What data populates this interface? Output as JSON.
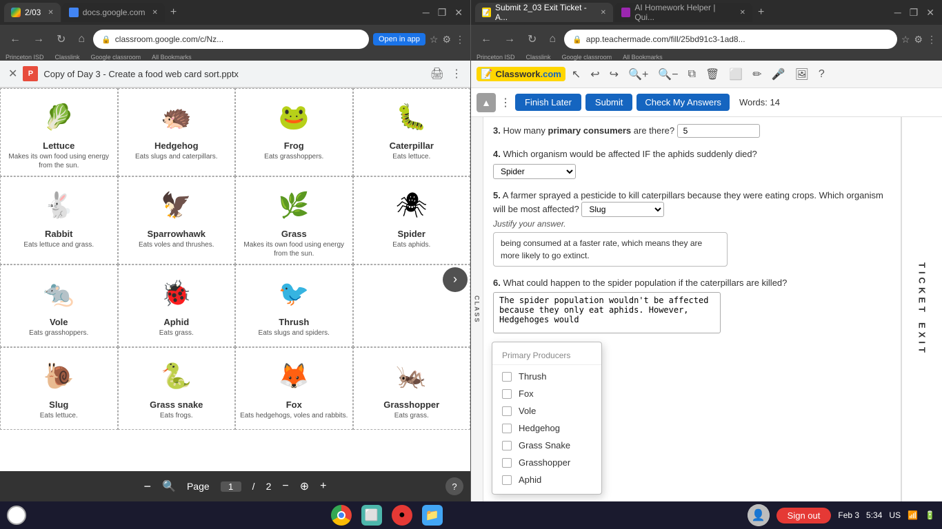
{
  "browser_left": {
    "tabs": [
      {
        "id": "tab1",
        "label": "2/03",
        "favicon": "google",
        "active": true
      },
      {
        "id": "tab2",
        "label": "docs.google.com",
        "favicon": "docs",
        "active": false
      }
    ],
    "address": "classroom.google.com/c/Nz...",
    "open_in_app": "Open in app"
  },
  "browser_right": {
    "tabs": [
      {
        "id": "tab3",
        "label": "Submit 2_03 Exit Ticket - A...",
        "favicon": "tm",
        "active": true
      },
      {
        "id": "tab4",
        "label": "AI Homework Helper | Qui...",
        "favicon": "ai",
        "active": false
      }
    ],
    "address": "app.teachermade.com/fill/25bd91c3-1ad8..."
  },
  "doc": {
    "title": "Copy of Day 3 - Create a food web card sort.pptx",
    "close_icon": "✕",
    "print_icon": "🖨",
    "more_icon": "⋮"
  },
  "cards": [
    {
      "name": "Lettuce",
      "desc": "Makes its own food using energy from the sun.",
      "emoji": "🥬"
    },
    {
      "name": "Hedgehog",
      "desc": "Eats slugs and caterpillars.",
      "emoji": "🦔"
    },
    {
      "name": "Frog",
      "desc": "Eats grasshoppers.",
      "emoji": "🐸"
    },
    {
      "name": "Caterpillar",
      "desc": "Eats lettuce.",
      "emoji": "🐛"
    },
    {
      "name": "Rabbit",
      "desc": "Eats lettuce and grass.",
      "emoji": "🐇"
    },
    {
      "name": "Sparrowhawk",
      "desc": "Eats voles and thrushes.",
      "emoji": "🦅"
    },
    {
      "name": "Grass",
      "desc": "Makes its own food using energy from the sun.",
      "emoji": "🌿"
    },
    {
      "name": "Spider",
      "desc": "Eats aphids.",
      "emoji": "🕷"
    },
    {
      "name": "Vole",
      "desc": "Eats grasshoppers.",
      "emoji": "🐀"
    },
    {
      "name": "Aphid",
      "desc": "Eats grass.",
      "emoji": "🐞"
    },
    {
      "name": "Thrush",
      "desc": "Eats slugs and spiders.",
      "emoji": "🐦"
    },
    {
      "name": "",
      "desc": "",
      "emoji": ""
    },
    {
      "name": "Slug",
      "desc": "Eats lettuce.",
      "emoji": "🐌"
    },
    {
      "name": "Grass snake",
      "desc": "Eats frogs.",
      "emoji": "🐍"
    },
    {
      "name": "Fox",
      "desc": "Eats hedgehogs, voles and rabbits.",
      "emoji": "🦊"
    },
    {
      "name": "Grasshopper",
      "desc": "Eats grass.",
      "emoji": "🦗"
    }
  ],
  "page_controls": {
    "label": "Page",
    "current": "1",
    "separator": "/",
    "total": "2"
  },
  "assignment": {
    "toolbar": {
      "finish_later": "Finish Later",
      "submit": "Submit",
      "check_answers": "Check My Answers",
      "words_label": "Words:",
      "words_count": "14"
    },
    "questions": [
      {
        "number": "3.",
        "text": "How many ",
        "bold": "primary consumers",
        "text2": " are there?",
        "input_value": "5"
      },
      {
        "number": "4.",
        "text": "Which organism would be affected IF the aphids suddenly died?",
        "select_value": "Spider"
      },
      {
        "number": "5.",
        "text": "A farmer sprayed a pesticide to kill caterpillars because they were eating crops.  Which organism will be most affected?",
        "select_value": "Slug",
        "justify_label": "Justify your answer.",
        "justify_value": "being consumed at a faster rate, which means they are more likely to go extinct."
      },
      {
        "number": "6.",
        "text": "What could happen to the spider population if the caterpillars are killed?",
        "textarea_value": "The spider population wouldn't be affected because they only eat aphids. However, Hedgehoges would "
      }
    ],
    "exit_text": "EXIT",
    "ticket_text": "TICKET",
    "class_label": "CLASS"
  },
  "dropdown": {
    "title": "Primary Producers",
    "items": [
      {
        "label": "Thrush",
        "checked": false
      },
      {
        "label": "Fox",
        "checked": false
      },
      {
        "label": "Vole",
        "checked": false
      },
      {
        "label": "Hedgehog",
        "checked": false
      },
      {
        "label": "Grass Snake",
        "checked": false
      },
      {
        "label": "Grasshopper",
        "checked": false
      },
      {
        "label": "Aphid",
        "checked": false
      }
    ]
  },
  "taskbar": {
    "sign_out": "Sign out",
    "date": "Feb 3",
    "time": "5:34",
    "region": "US"
  },
  "bookmarks": {
    "princeton": "Princeton ISD",
    "classlink": "Classlink",
    "google_classroom": "Google classroom",
    "all_bookmarks": "All Bookmarks"
  }
}
